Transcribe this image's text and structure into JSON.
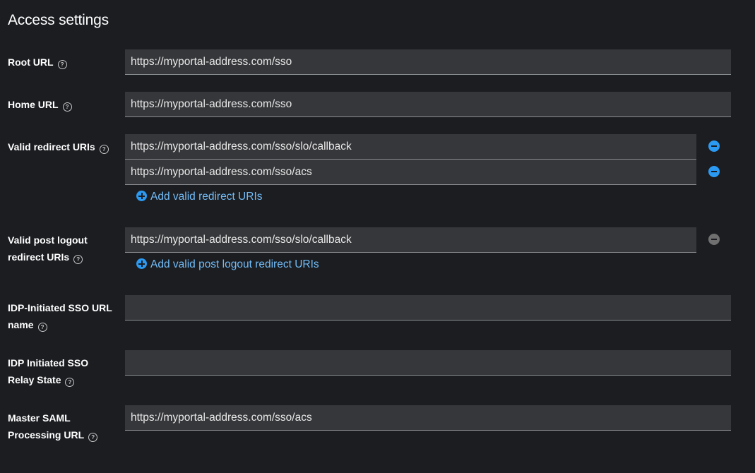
{
  "section_title": "Access settings",
  "root_url": {
    "label": "Root URL",
    "value": "https://myportal-address.com/sso"
  },
  "home_url": {
    "label": "Home URL",
    "value": "https://myportal-address.com/sso"
  },
  "valid_redirect_uris": {
    "label": "Valid redirect URIs",
    "values": [
      "https://myportal-address.com/sso/slo/callback",
      "https://myportal-address.com/sso/acs"
    ],
    "add_label": "Add valid redirect URIs"
  },
  "valid_post_logout": {
    "label_line1": "Valid post logout",
    "label_line2": "redirect URIs",
    "values": [
      "https://myportal-address.com/sso/slo/callback"
    ],
    "add_label": "Add valid post logout redirect URIs"
  },
  "idp_sso_url_name": {
    "label_line1": "IDP-Initiated SSO URL",
    "label_line2": "name",
    "value": ""
  },
  "idp_relay_state": {
    "label_line1": "IDP Initiated SSO",
    "label_line2": "Relay State",
    "value": ""
  },
  "master_saml": {
    "label_line1": "Master SAML",
    "label_line2": "Processing URL",
    "value": "https://myportal-address.com/sso/acs"
  },
  "colors": {
    "background": "#1b1d21",
    "input_bg": "#36373a",
    "accent": "#2b9af3",
    "link": "#73bcf7"
  }
}
